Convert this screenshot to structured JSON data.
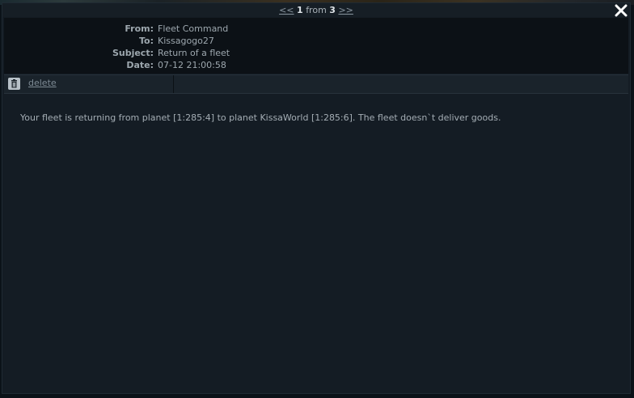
{
  "pager": {
    "prev": "<<",
    "current": "1",
    "from_word": "from",
    "total": "3",
    "next": ">>"
  },
  "header": {
    "from_label": "From:",
    "from_value": "Fleet Command",
    "to_label": "To:",
    "to_value": "Kissagogo27",
    "subject_label": "Subject:",
    "subject_value": "Return of a fleet",
    "date_label": "Date:",
    "date_value": "07-12 21:00:58"
  },
  "toolbar": {
    "delete_label": "delete",
    "trash_icon": "trash-icon"
  },
  "message": {
    "body": "Your fleet is returning from planet [1:285:4] to planet KissaWorld [1:285:6]. The fleet doesn`t deliver goods."
  },
  "colors": {
    "background": "#141c24",
    "header_bg": "#0c1116",
    "text": "#9aa4ac",
    "link": "#7e8b95"
  }
}
